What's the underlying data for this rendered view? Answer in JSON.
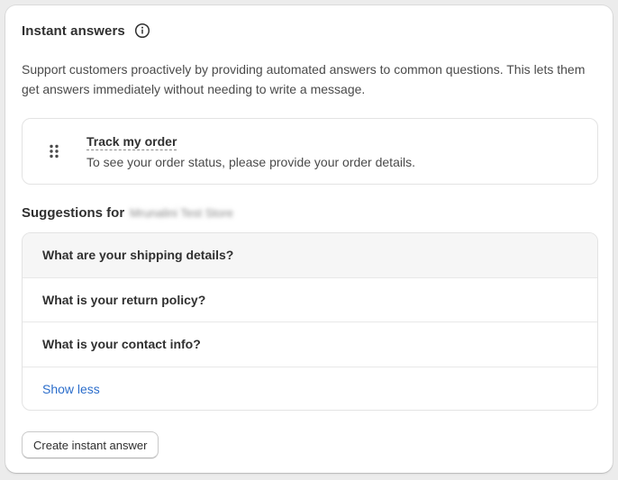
{
  "card": {
    "title": "Instant answers",
    "info_icon": "info-icon",
    "description": "Support customers proactively by providing automated answers to common questions. This lets them get answers immediately without needing to write a message."
  },
  "instant_answer": {
    "drag_icon": "drag-handle-icon",
    "title": "Track my order",
    "subtitle": "To see your order status, please provide your order details."
  },
  "suggestions": {
    "heading": "Suggestions for",
    "store_name": "Mrunalini Test Store",
    "items": [
      "What are your shipping details?",
      "What is your return policy?",
      "What is your contact info?"
    ],
    "toggle_label": "Show less"
  },
  "actions": {
    "create_label": "Create instant answer"
  },
  "colors": {
    "link": "#2c6ecb",
    "text": "#303030",
    "border": "#e3e3e3",
    "hover_row": "#f6f6f6"
  }
}
